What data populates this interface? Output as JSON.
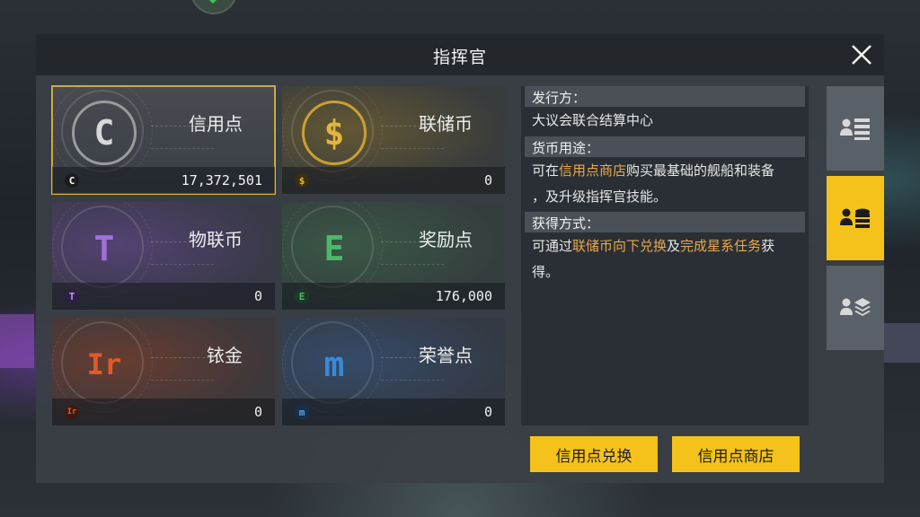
{
  "window": {
    "title": "指挥官"
  },
  "currencies": [
    {
      "name": "信用点",
      "amount": "17,372,501",
      "symbol": "C",
      "color": "#d8d8d8"
    },
    {
      "name": "联储币",
      "amount": "0",
      "symbol": "$",
      "color": "#e2b63a"
    },
    {
      "name": "物联币",
      "amount": "0",
      "symbol": "T",
      "color": "#a070d8"
    },
    {
      "name": "奖励点",
      "amount": "176,000",
      "symbol": "E",
      "color": "#4cb86a"
    },
    {
      "name": "铱金",
      "amount": "0",
      "symbol": "Ir",
      "color": "#e05a2a"
    },
    {
      "name": "荣誉点",
      "amount": "0",
      "symbol": "m",
      "color": "#3a8ad8"
    }
  ],
  "info": {
    "issuer_heading": "发行方：",
    "issuer_text": "大议会联合结算中心",
    "usage_heading": "货币用途：",
    "usage_pre": "可在",
    "usage_link": "信用点商店",
    "usage_post": "购买最基础的舰船和装备",
    "usage_line2": "，及升级指挥官技能。",
    "obtain_heading": "获得方式：",
    "obtain_pre": "可通过",
    "obtain_link1": "联储币向下兑换",
    "obtain_mid": "及",
    "obtain_link2": "完成星系任务",
    "obtain_post": "获",
    "obtain_line2": "得。"
  },
  "tabs": [
    {
      "icon": "profile-list-icon",
      "active": false
    },
    {
      "icon": "profile-coins-icon",
      "active": true
    },
    {
      "icon": "profile-layers-icon",
      "active": false
    }
  ],
  "buttons": {
    "exchange": "信用点兑换",
    "shop": "信用点商店"
  },
  "colors": {
    "accent": "#f4c21a",
    "highlight": "#e8a94a"
  }
}
